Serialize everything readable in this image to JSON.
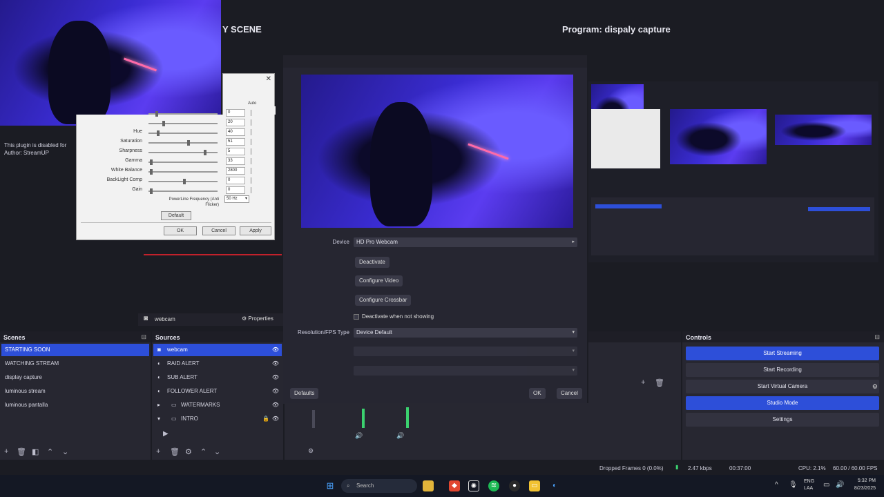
{
  "preview": {
    "scene_title": "Y SCENE",
    "program_title": "Program: dispaly capture",
    "plugin_notice": "This plugin is disabled for",
    "plugin_author": "Author: StreamUP"
  },
  "props_dialog": {
    "auto_header": "Auto",
    "rows": [
      {
        "label": "",
        "value": "0"
      },
      {
        "label": "",
        "value": "20"
      },
      {
        "label": "Hue",
        "value": "40"
      },
      {
        "label": "Saturation",
        "value": "51"
      },
      {
        "label": "Sharpness",
        "value": "5"
      },
      {
        "label": "Gamma",
        "value": "33"
      },
      {
        "label": "White Balance",
        "value": "2800"
      },
      {
        "label": "BackLight Comp",
        "value": "0"
      },
      {
        "label": "Gain",
        "value": "0"
      }
    ],
    "powerline_label": "PowerLine Frequency (Anti Flicker)",
    "powerline_value": "50 Hz",
    "default_button": "Default",
    "ok_button": "OK",
    "cancel_button": "Cancel",
    "apply_button": "Apply"
  },
  "source_props": {
    "device_label": "Device",
    "device_value": "HD Pro Webcam",
    "btn_deactivate": "Deactivate",
    "btn_configure_video": "Configure Video",
    "btn_configure_crossbar": "Configure Crossbar",
    "deactivate_checkbox": "Deactivate when not showing",
    "restype_label": "Resolution/FPS Type",
    "restype_value": "Device Default",
    "defaults_button": "Defaults",
    "ok_button": "OK",
    "cancel_button": "Cancel"
  },
  "source_toolbar": {
    "source_name": "webcam",
    "properties_button": "Properties"
  },
  "scenes": {
    "title": "Scenes",
    "items": [
      "STARTING SOON",
      "WATCHING STREAM",
      "display capture",
      "luminous stream",
      "luminous pantalla"
    ]
  },
  "sources": {
    "title": "Sources",
    "items": [
      "webcam",
      "RAID ALERT",
      "SUB ALERT",
      "FOLLOWER ALERT",
      "WATERMARKS",
      "INTRO"
    ]
  },
  "controls": {
    "title": "Controls",
    "buttons": [
      "Start Streaming",
      "Start Recording",
      "Start Virtual Camera",
      "Studio Mode",
      "Settings"
    ]
  },
  "status": {
    "dropped": "Dropped Frames 0 (0.0%)",
    "bitrate": "2.47 kbps",
    "stream_time": "00:37:00",
    "cpu": "CPU: 2.1%",
    "fps": "60.00 / 60.00 FPS"
  },
  "taskbar": {
    "search_placeholder": "Search",
    "lang_top": "ENG",
    "lang_bottom": "LAA",
    "time": "5:32 PM",
    "date": "8/23/2025"
  }
}
